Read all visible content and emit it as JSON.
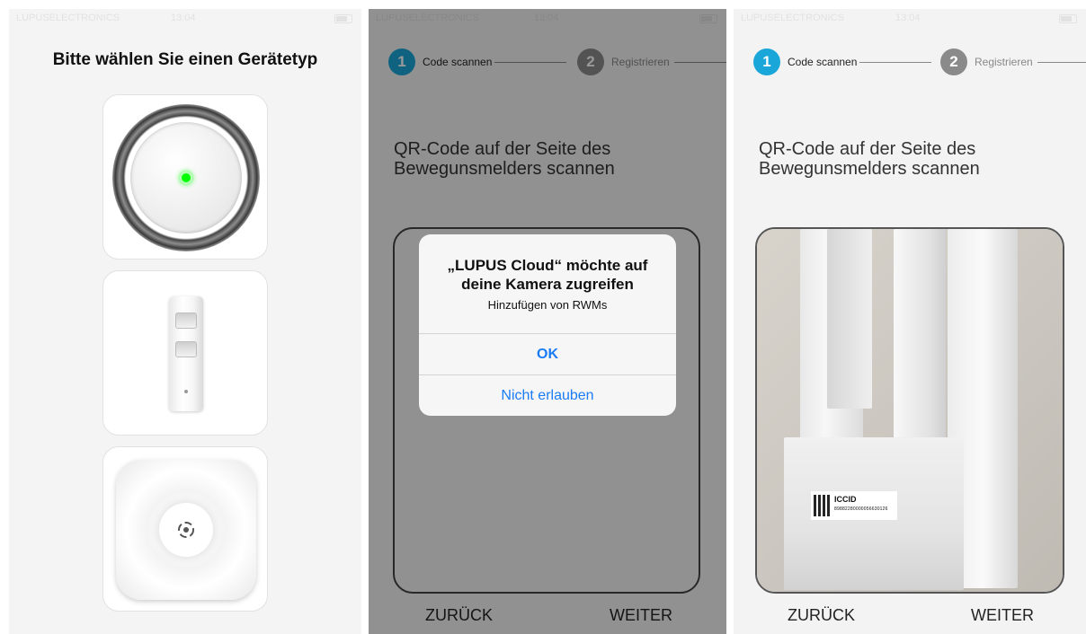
{
  "status_bar": {
    "carrier": "LUPUSELECTRONICS",
    "time": "13:04"
  },
  "panel1": {
    "title": "Bitte wählen Sie einen Gerätetyp",
    "devices": [
      "siren",
      "motion-detector",
      "hub"
    ]
  },
  "stepper": {
    "step1_number": "1",
    "step1_label": "Code scannen",
    "step2_number": "2",
    "step2_label": "Registrieren",
    "active_color": "#1aa6d8",
    "inactive_color": "#8a8a8a"
  },
  "scan": {
    "instruction_line1": "QR-Code auf der Seite des",
    "instruction_line2": "Bewegunsmelders scannen"
  },
  "alert": {
    "title": "„LUPUS Cloud“ möchte auf deine Kamera zugreifen",
    "message": "Hinzufügen von RWMs",
    "ok_label": "OK",
    "deny_label": "Nicht erlauben"
  },
  "footer": {
    "back_label": "ZURÜCK",
    "next_label": "WEITER"
  },
  "camera": {
    "label_text": "ICCID",
    "label_number": "89882280000056630126"
  }
}
